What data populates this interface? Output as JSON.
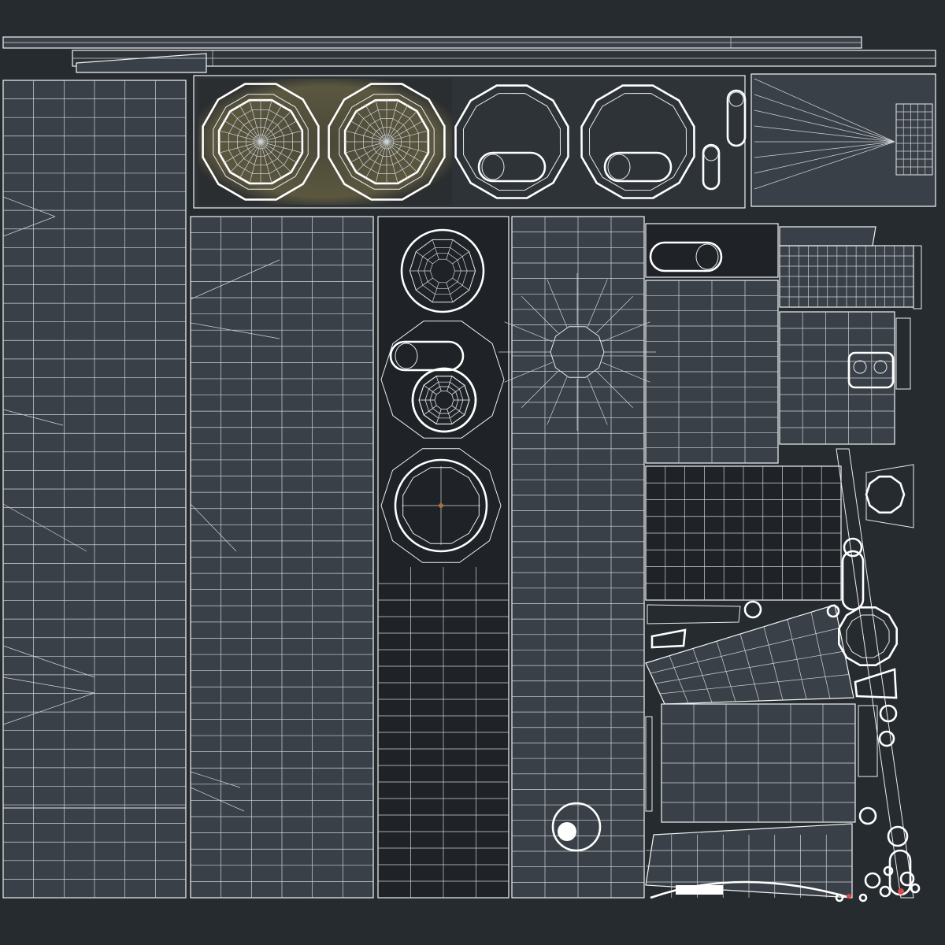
{
  "colors": {
    "background": "#262b30",
    "island_fill": "#3a4047",
    "island_fill_dark": "#1f2327",
    "island_fill_mid": "#2e3338",
    "wire": "#e9ecee",
    "glow": "#a09a6e",
    "accent_red": "#d94b4b"
  },
  "icons": [
    "circle-island-icon",
    "capsule-island-icon",
    "gear-island-icon"
  ]
}
